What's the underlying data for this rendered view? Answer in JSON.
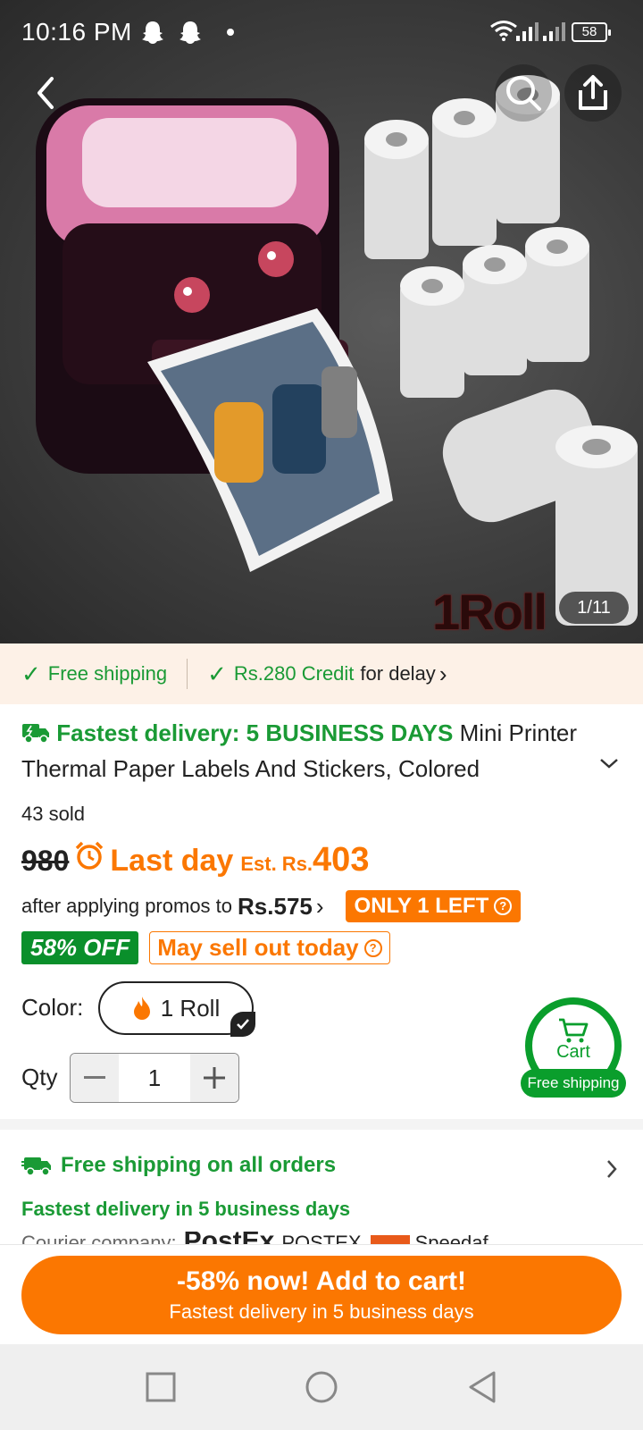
{
  "status_bar": {
    "time": "10:16 PM",
    "battery": "58",
    "icons": [
      "snapchat-ghost-icon",
      "snapchat-ghost-icon",
      "notification-dot",
      "wifi-icon",
      "signal-icon",
      "signal-icon",
      "battery-icon"
    ]
  },
  "hero": {
    "image_counter": "1/11",
    "image_overlay_text": "1Roll",
    "icons": [
      "back-icon",
      "search-icon",
      "share-icon"
    ]
  },
  "shipping_banner": {
    "free_shipping": "Free shipping",
    "credit": "Rs.280 Credit",
    "credit_suffix": "for delay",
    "chevron": "›"
  },
  "product": {
    "fastest_delivery": "Fastest delivery: 5 BUSINESS DAYS",
    "title": "Mini Printer Thermal Paper Labels And Stickers, Colored",
    "sold": "43 sold"
  },
  "price": {
    "original": "980",
    "last_day": "Last day",
    "est_label": "Est. Rs.",
    "est_value": "403",
    "after_promo_text": "after applying promos to",
    "after_promo_price": "Rs.575",
    "promo_chevron": "›",
    "only_left": "ONLY 1 LEFT",
    "discount_badge": "58% OFF",
    "sellout": "May sell out today",
    "help_glyph": "?"
  },
  "options": {
    "color_label": "Color:",
    "color_value": "1 Roll",
    "qty_label": "Qty",
    "qty_value": "1"
  },
  "cart_float": {
    "label": "Cart",
    "badge": "Free shipping"
  },
  "shipping_section": {
    "title": "Free shipping on all orders",
    "subtitle": "Fastest delivery in 5 business days",
    "courier_label": "Courier company:",
    "courier_1": "PostEx",
    "courier_2": "POSTEX",
    "courier_3": "Speedaf"
  },
  "cta": {
    "line1": "-58% now! Add to cart!",
    "line2": "Fastest delivery in 5 business days"
  },
  "colors": {
    "accent_orange": "#fb7701",
    "green": "#1a9a35",
    "badge_green": "#0a8f2b",
    "banner_bg": "#fdf1e7"
  }
}
